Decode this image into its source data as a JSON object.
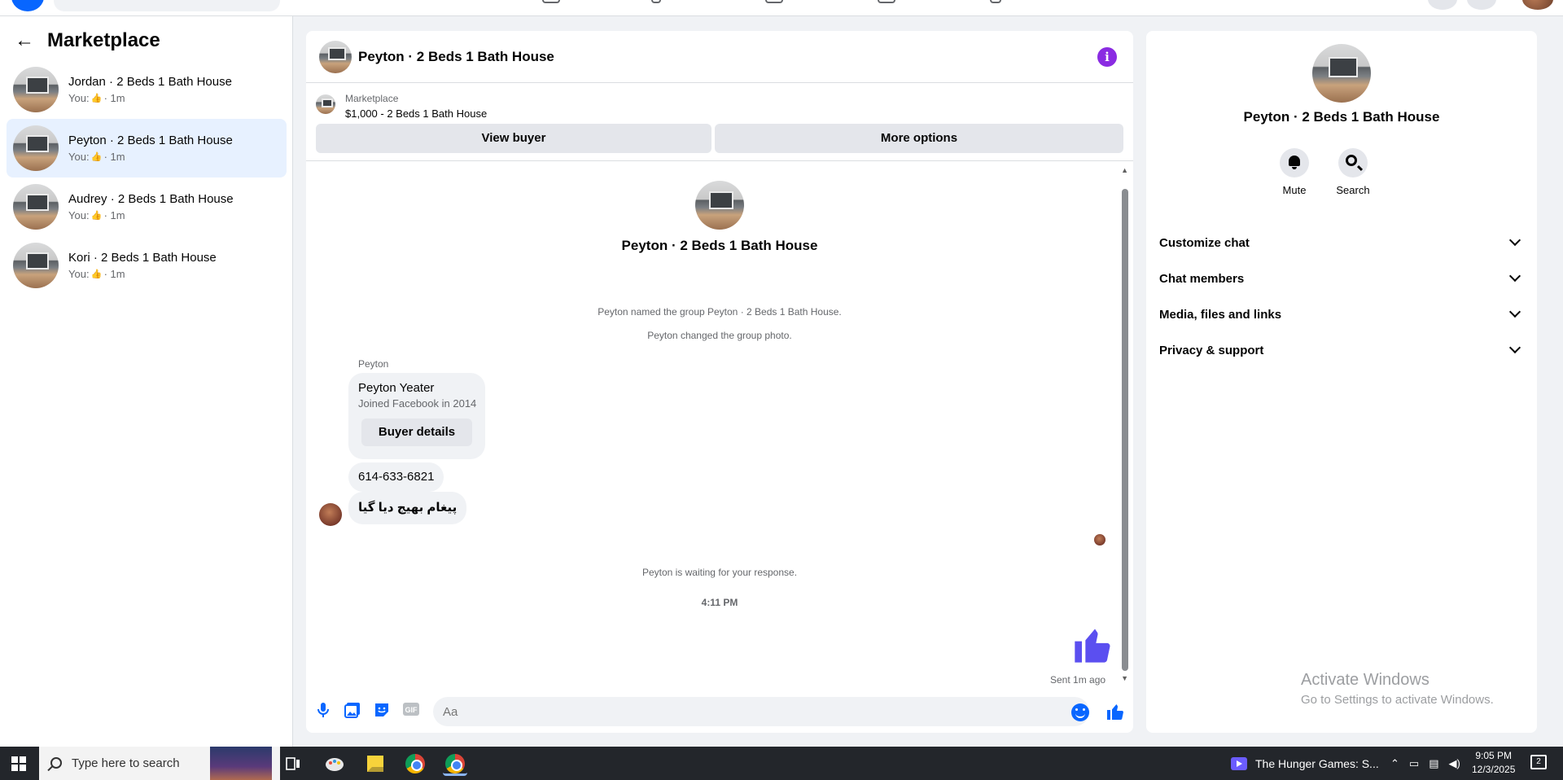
{
  "sidebar": {
    "title": "Marketplace",
    "conversations": [
      {
        "name": "Jordan · 2 Beds 1 Bath House",
        "prefix": "You:",
        "time": "· 1m"
      },
      {
        "name": "Peyton · 2 Beds 1 Bath House",
        "prefix": "You:",
        "time": "· 1m"
      },
      {
        "name": "Audrey · 2 Beds 1 Bath House",
        "prefix": "You:",
        "time": "· 1m"
      },
      {
        "name": "Kori · 2 Beds 1 Bath House",
        "prefix": "You:",
        "time": "· 1m"
      }
    ]
  },
  "chat": {
    "title": "Peyton · 2 Beds 1 Bath House",
    "marketplace_label": "Marketplace",
    "listing": "$1,000 - 2 Beds 1 Bath House",
    "view_buyer": "View buyer",
    "more_options": "More options",
    "convo_title": "Peyton · 2 Beds 1 Bath House",
    "system_messages": [
      "Peyton named the group Peyton · 2 Beds 1 Bath House.",
      "Peyton changed the group photo."
    ],
    "sender": "Peyton",
    "card": {
      "name": "Peyton Yeater",
      "joined": "Joined Facebook in 2014",
      "button": "Buyer details"
    },
    "phone": "614-633-6821",
    "urdu_message": "پیغام بھیج دیا گیا",
    "waiting": "Peyton is waiting for your response.",
    "time_separator": "4:11 PM",
    "sent_status": "Sent 1m ago",
    "input_placeholder": "Aa"
  },
  "details": {
    "title": "Peyton · 2 Beds 1 Bath House",
    "mute": "Mute",
    "search": "Search",
    "sections": [
      "Customize chat",
      "Chat members",
      "Media, files and links",
      "Privacy & support"
    ]
  },
  "watermark": {
    "line1": "Activate Windows",
    "line2": "Go to Settings to activate Windows."
  },
  "taskbar": {
    "search_placeholder": "Type here to search",
    "media_title": "The Hunger Games: S...",
    "time": "9:05 PM",
    "date": "12/3/2025",
    "notification_count": "2"
  },
  "colors": {
    "accent": "#0866ff",
    "info": "#8a2be2",
    "like": "#5b4ff0"
  }
}
